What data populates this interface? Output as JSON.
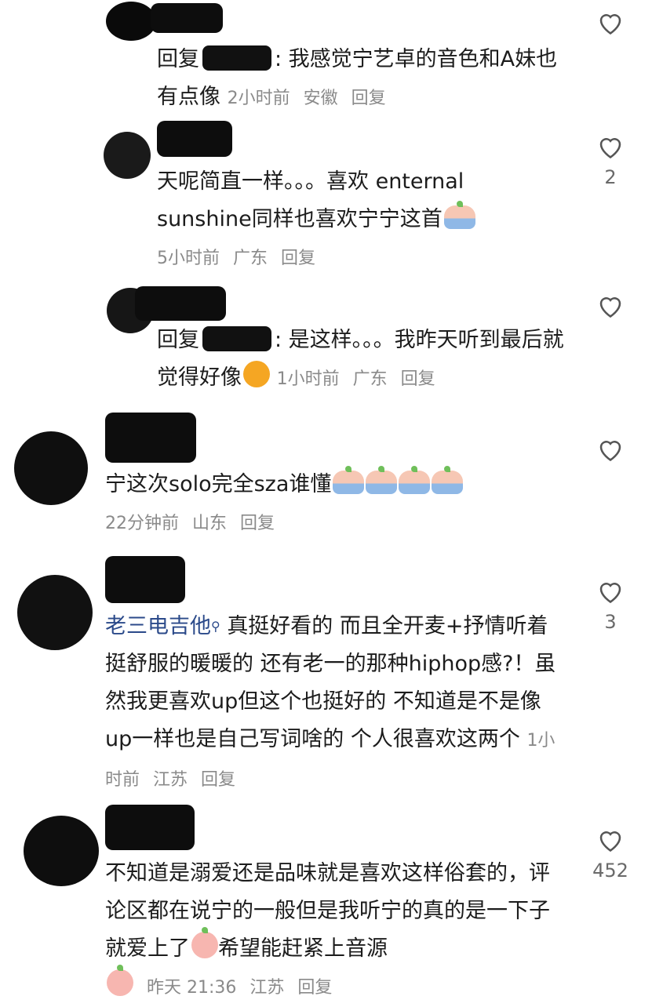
{
  "comments": [
    {
      "id": "c1",
      "text": ": 我感觉宁艺卓的音色和A妹也有点像",
      "reply_prefix": "回复",
      "meta": {
        "time": "2小时前",
        "location": "安徽",
        "reply": "回复"
      },
      "likes": ""
    },
    {
      "id": "c2",
      "text": "天呢简直一样。。。喜欢 enternal sunshine同样也喜欢宁宁这首",
      "meta": {
        "time": "5小时前",
        "location": "广东",
        "reply": "回复"
      },
      "likes": "2"
    },
    {
      "id": "c3",
      "text": ": 是这样。。。我昨天听到最后就觉得好像",
      "reply_prefix": "回复",
      "meta": {
        "time": "1小时前",
        "location": "广东",
        "reply": "回复"
      },
      "likes": ""
    },
    {
      "id": "c4",
      "text": "宁这次solo完全sza谁懂",
      "meta": {
        "time": "22分钟前",
        "location": "山东",
        "reply": "回复"
      },
      "likes": ""
    },
    {
      "id": "c5",
      "author": "老三电吉他",
      "text": "真挺好看的 而且全开麦+抒情听着挺舒服的暖暖的 还有老一的那种hiphop感?！虽然我更喜欢up但这个也挺好的 不知道是不是像up一样也是自己写词啥的 个人很喜欢这两个",
      "meta": {
        "time": "1小时前",
        "location": "江苏",
        "reply": "回复"
      },
      "likes": "3"
    },
    {
      "id": "c6",
      "text": "不知道是溺爱还是品味就是喜欢这样俗套的，评论区都在说宁的一般但是我听宁的真的是一下子就爱上了",
      "text_tail": "希望能赶紧上音源",
      "meta": {
        "time": "昨天 21:36",
        "location": "江苏",
        "reply": "回复"
      },
      "likes": "452"
    }
  ],
  "icons": {
    "like": "heart-outline-icon",
    "emoji": "peach-emoji-icon"
  },
  "colors": {
    "text": "#1c1c1c",
    "meta": "#8a8a8a",
    "author": "#2b4a8a"
  }
}
